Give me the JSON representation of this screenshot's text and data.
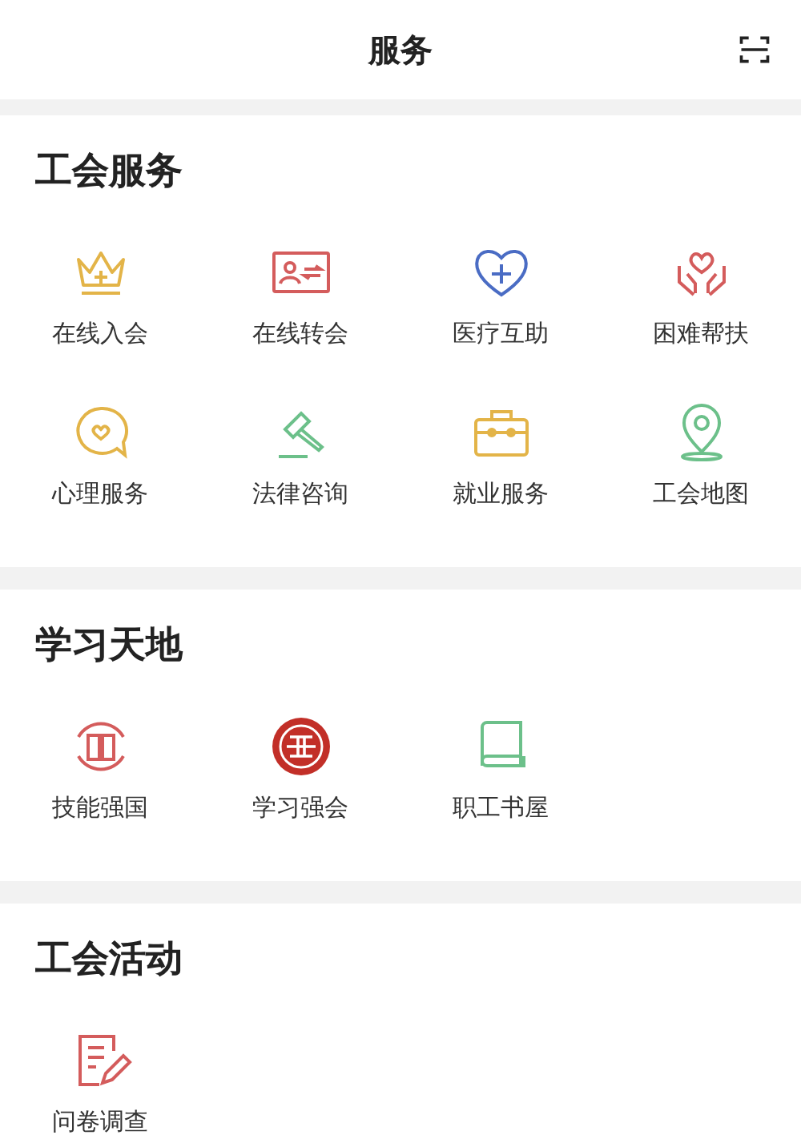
{
  "header": {
    "title": "服务"
  },
  "sections": [
    {
      "title": "工会服务",
      "items": [
        {
          "label": "在线入会",
          "kind": "crown"
        },
        {
          "label": "在线转会",
          "kind": "card"
        },
        {
          "label": "医疗互助",
          "kind": "heart"
        },
        {
          "label": "困难帮扶",
          "kind": "hands"
        },
        {
          "label": "心理服务",
          "kind": "chat"
        },
        {
          "label": "法律咨询",
          "kind": "gavel"
        },
        {
          "label": "就业服务",
          "kind": "briefcase"
        },
        {
          "label": "工会地图",
          "kind": "pin"
        }
      ]
    },
    {
      "title": "学习天地",
      "items": [
        {
          "label": "技能强国",
          "kind": "bookcircle"
        },
        {
          "label": "学习强会",
          "kind": "emblem"
        },
        {
          "label": "职工书屋",
          "kind": "book"
        }
      ]
    },
    {
      "title": "工会活动",
      "items": [
        {
          "label": "问卷调查",
          "kind": "survey"
        }
      ]
    }
  ]
}
